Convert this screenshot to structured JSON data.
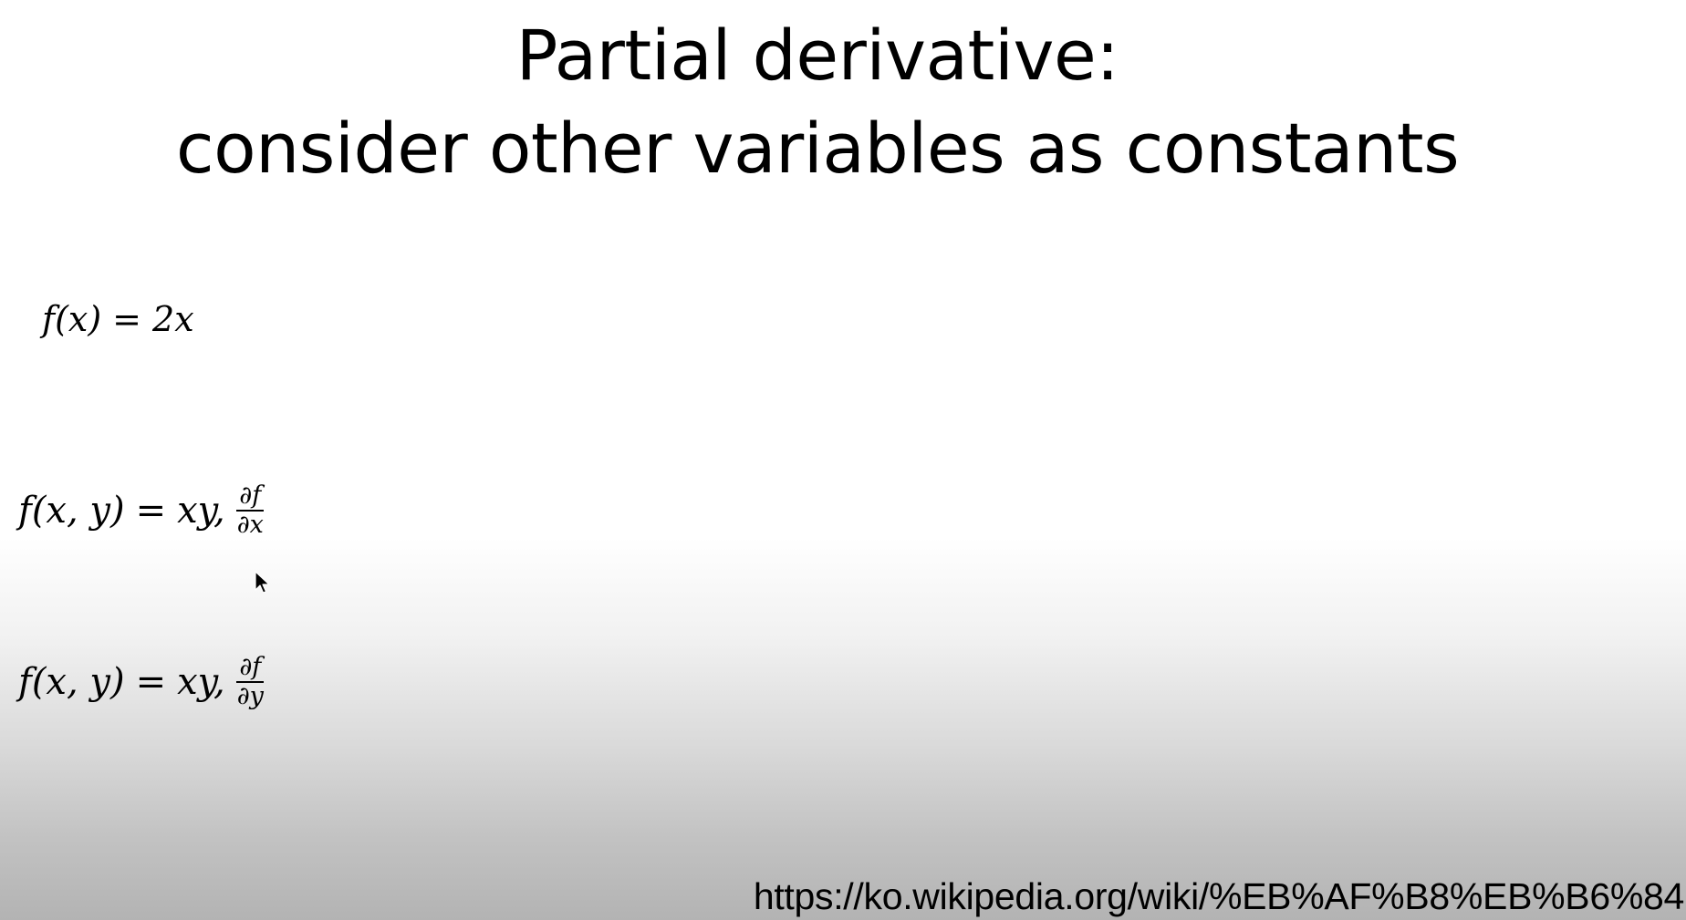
{
  "slide": {
    "title_line1": "Partial derivative:",
    "title_line2": "consider other variables as constants"
  },
  "formulas": [
    {
      "fn": "f",
      "args": "(x)",
      "equals": "=",
      "rhs": "2x"
    },
    {
      "fn": "f",
      "args": "(x, y)",
      "equals": "=",
      "rhs": "xy,",
      "frac_num": "∂f",
      "frac_den": "∂x"
    },
    {
      "fn": "f",
      "args": "(x, y)",
      "equals": "=",
      "rhs": "xy,",
      "frac_num": "∂f",
      "frac_den": "∂y"
    }
  ],
  "source_url": "https://ko.wikipedia.org/wiki/%EB%AF%B8%EB%B6%84",
  "icons": {
    "cursor": "mouse-pointer-icon"
  }
}
